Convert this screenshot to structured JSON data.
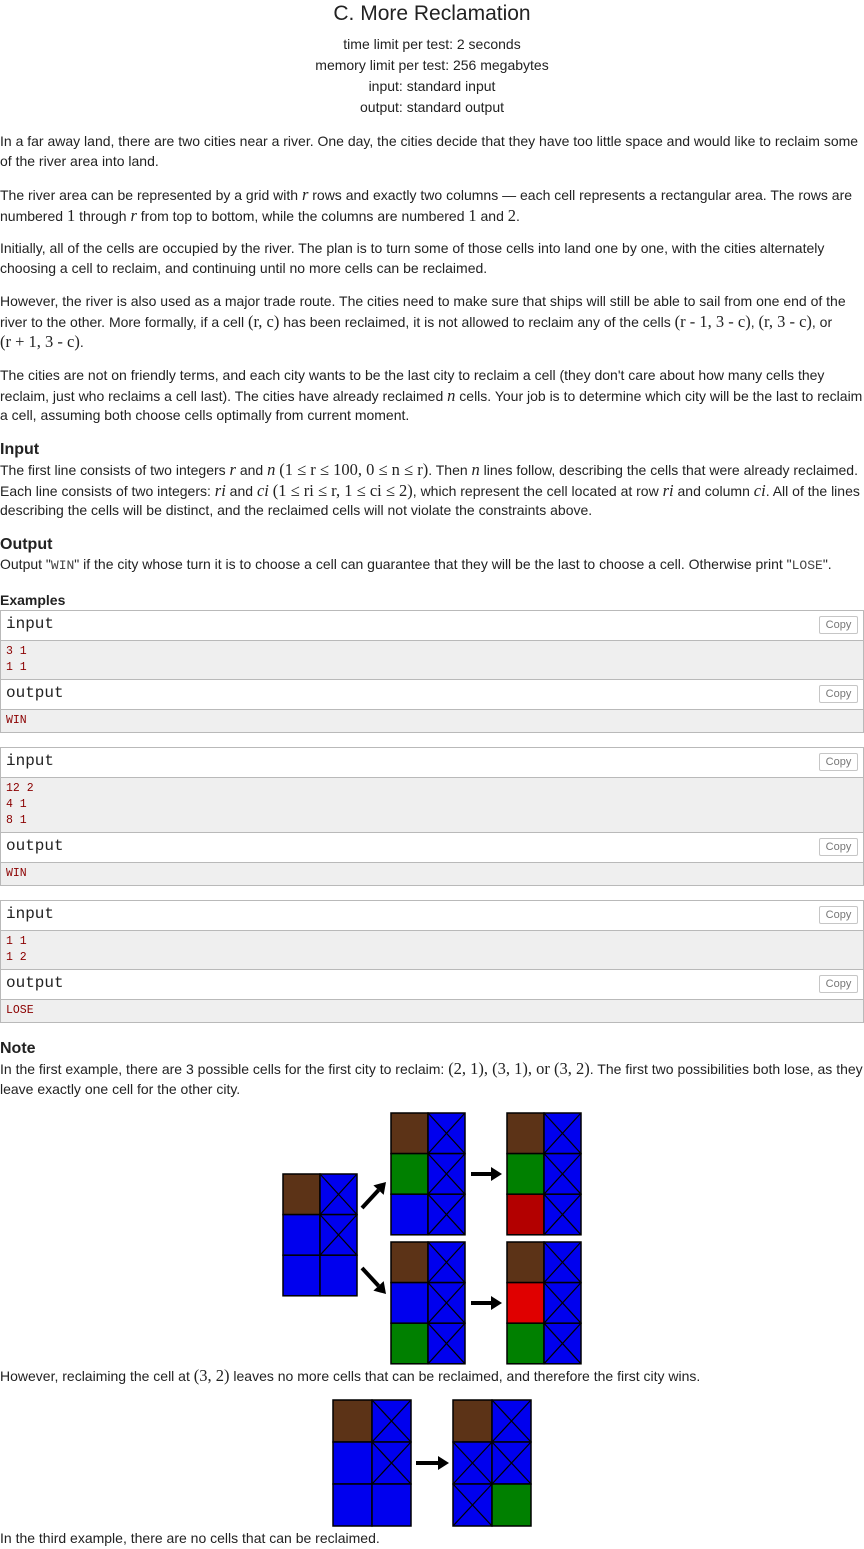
{
  "title": "C. More Reclamation",
  "header": {
    "time_limit": "time limit per test: 2 seconds",
    "memory_limit": "memory limit per test: 256 megabytes",
    "input": "input: standard input",
    "output": "output: standard output"
  },
  "statement": {
    "p1": "In a far away land, there are two cities near a river. One day, the cities decide that they have too little space and would like to reclaim some of the river area into land.",
    "p2_a": "The river area can be represented by a grid with ",
    "p2_r": "r",
    "p2_b": " rows and exactly two columns — each cell represents a rectangular area. The rows are numbered ",
    "p2_one": "1",
    "p2_c": " through ",
    "p2_r2": "r",
    "p2_d": " from top to bottom, while the columns are numbered ",
    "p2_one2": "1",
    "p2_e": " and ",
    "p2_two": "2",
    "p2_f": ".",
    "p3": "Initially, all of the cells are occupied by the river. The plan is to turn some of those cells into land one by one, with the cities alternately choosing a cell to reclaim, and continuing until no more cells can be reclaimed.",
    "p4_a": "However, the river is also used as a major trade route. The cities need to make sure that ships will still be able to sail from one end of the river to the other. More formally, if a cell ",
    "p4_m1": "(r, c)",
    "p4_b": " has been reclaimed, it is not allowed to reclaim any of the cells ",
    "p4_m2": "(r - 1, 3 - c)",
    "p4_c": ", ",
    "p4_m3": "(r, 3 - c)",
    "p4_d": ", or",
    "p4_m4": "(r + 1, 3 - c)",
    "p4_e": ".",
    "p5_a": "The cities are not on friendly terms, and each city wants to be the last city to reclaim a cell (they don't care about how many cells they reclaim, just who reclaims a cell last). The cities have already reclaimed ",
    "p5_n": "n",
    "p5_b": " cells. Your job is to determine which city will be the last to reclaim a cell, assuming both choose cells optimally from current moment."
  },
  "input_section": {
    "heading": "Input",
    "l1_a": "The first line consists of two integers ",
    "l1_r": "r",
    "l1_b": " and ",
    "l1_n": "n",
    "l1_m": "(1 ≤ r ≤ 100, 0 ≤ n ≤ r)",
    "l1_c": ". Then ",
    "l1_n2": "n",
    "l1_d": " lines follow, describing the cells that were already reclaimed.",
    "l2_a": "Each line consists of two integers: ",
    "l2_ri": "ri",
    "l2_b": " and ",
    "l2_ci": "ci",
    "l2_m": "(1 ≤ ri ≤ r, 1 ≤ ci ≤ 2)",
    "l2_c": ", which represent the cell located at row ",
    "l2_ri2": "ri",
    "l2_d": " and column ",
    "l2_ci2": "ci",
    "l2_e": ". All of the lines",
    "l3": "describing the cells will be distinct, and the reclaimed cells will not violate the constraints above."
  },
  "output_section": {
    "heading": "Output",
    "a": "Output \"",
    "win": "WIN",
    "b": "\" if the city whose turn it is to choose a cell can guarantee that they will be the last to choose a cell. Otherwise print \"",
    "lose": "LOSE",
    "c": "\"."
  },
  "examples": {
    "heading": "Examples",
    "input_label": "input",
    "output_label": "output",
    "copy_label": "Copy",
    "items": [
      {
        "input": "3 1\n1 1",
        "output": "WIN"
      },
      {
        "input": "12 2\n4 1\n8 1",
        "output": "WIN"
      },
      {
        "input": "1 1\n1 2",
        "output": "LOSE"
      }
    ]
  },
  "note": {
    "heading": "Note",
    "n1_a": "In the first example, there are 3 possible cells for the first city to reclaim: ",
    "n1_m": "(2, 1), (3, 1), or (3, 2)",
    "n1_b": ". The first two possibilities both lose, as they",
    "n1_c": "leave exactly one cell for the other city.",
    "n2_a": "However, reclaiming the cell at ",
    "n2_m": "(3, 2)",
    "n2_b": " leaves no more cells that can be reclaimed, and therefore the first city wins.",
    "n3": "In the third example, there are no cells that can be reclaimed."
  },
  "colors": {
    "river": "#0000ee",
    "land": "#5c3317",
    "green": "#008000",
    "dark_red": "#b30000",
    "red": "#e00000"
  }
}
